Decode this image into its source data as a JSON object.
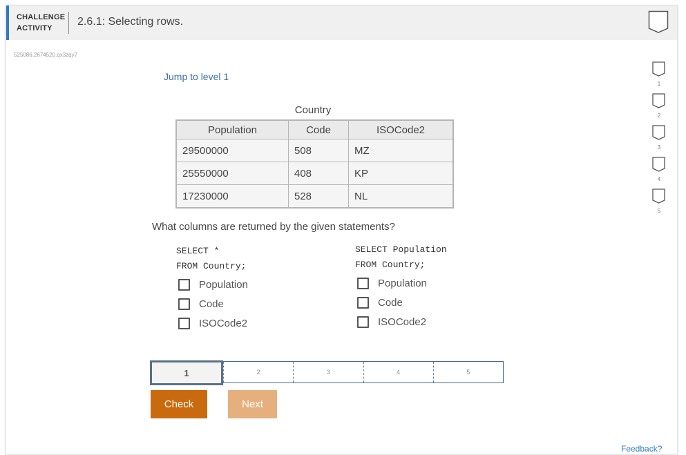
{
  "header": {
    "type_line1": "CHALLENGE",
    "type_line2": "ACTIVITY",
    "title": "2.6.1: Selecting rows."
  },
  "activity_code": "525086.2674520.qx3zqy7",
  "jump_link": "Jump to level 1",
  "table": {
    "caption": "Country",
    "columns": [
      "Population",
      "Code",
      "ISOCode2"
    ],
    "rows": [
      [
        "29500000",
        "508",
        "MZ"
      ],
      [
        "25550000",
        "408",
        "KP"
      ],
      [
        "17230000",
        "528",
        "NL"
      ]
    ]
  },
  "question": "What columns are returned by the given statements?",
  "statements": [
    {
      "line1": "SELECT *",
      "line2": "FROM Country;",
      "options": [
        "Population",
        "Code",
        "ISOCode2"
      ],
      "checked": [
        false,
        false,
        false
      ]
    },
    {
      "line1": "SELECT Population",
      "line2": "FROM Country;",
      "options": [
        "Population",
        "Code",
        "ISOCode2"
      ],
      "checked": [
        false,
        false,
        false
      ]
    }
  ],
  "levels": [
    "1",
    "2",
    "3",
    "4",
    "5"
  ],
  "current_level": "1",
  "buttons": {
    "check": "Check",
    "next": "Next"
  },
  "progress_levels": [
    "1",
    "2",
    "3",
    "4",
    "5"
  ],
  "feedback_link": "Feedback?",
  "colors": {
    "accent": "#2f7bc0",
    "check_button": "#c96a0e",
    "next_button_disabled": "#e6b07e",
    "level_border": "#3f6a95"
  },
  "icons": {
    "header_badge": "level-badge-icon",
    "progress_badge": "level-badge-icon",
    "checkbox": "checkbox-unchecked-icon"
  }
}
